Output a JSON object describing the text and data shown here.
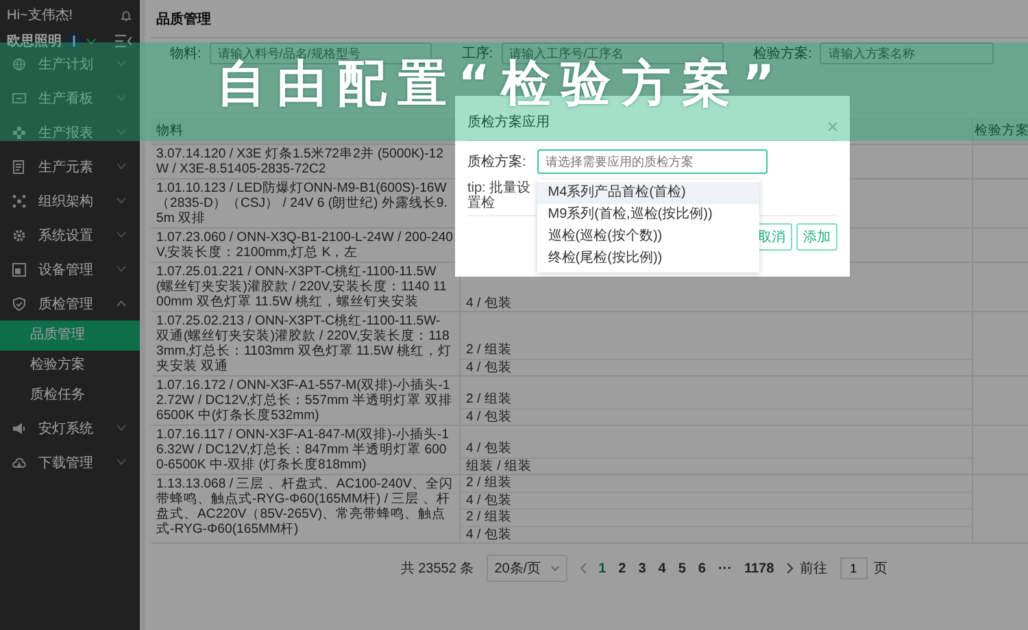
{
  "sidebar": {
    "greeting": "Hi~支伟杰!",
    "company": "欧思照明",
    "items": [
      {
        "label": "生产计划",
        "expanded": false
      },
      {
        "label": "生产看板",
        "expanded": false
      },
      {
        "label": "生产报表",
        "expanded": false
      },
      {
        "label": "生产元素",
        "expanded": false
      },
      {
        "label": "组织架构",
        "expanded": false
      },
      {
        "label": "系统设置",
        "expanded": false
      },
      {
        "label": "设备管理",
        "expanded": false
      },
      {
        "label": "质检管理",
        "expanded": true,
        "children": [
          {
            "label": "品质管理",
            "selected": true
          },
          {
            "label": "检验方案",
            "selected": false
          },
          {
            "label": "质检任务",
            "selected": false
          }
        ]
      },
      {
        "label": "安灯系统",
        "expanded": false
      },
      {
        "label": "下载管理",
        "expanded": false
      }
    ]
  },
  "page_title": "品质管理",
  "filters": [
    {
      "label": "物料:",
      "placeholder": "请输入料号/品名/规格型号"
    },
    {
      "label": "工序:",
      "placeholder": "请输入工序号/工序名"
    },
    {
      "label": "检验方案:",
      "placeholder": "请输入方案名称"
    }
  ],
  "table": {
    "columns": {
      "material": "物料",
      "scheme": "检验方案"
    },
    "rows": [
      {
        "material": "3.07.14.120 / X3E 灯条1.5米72串2并 (5000K)-12W / X3E-8.51405-2835-72C2"
      },
      {
        "material": "1.01.10.123 / LED防爆灯ONN-M9-B1(600S)-16W（2835-D）（CSJ） / 24V 6 (朗世纪) 外露线长9.5m 双排"
      },
      {
        "material": "1.07.23.060 / ONN-X3Q-B1-2100-L-24W / 200-240V,安装长度：2100mm,灯总 K，左"
      },
      {
        "material": "1.07.25.01.221 / ONN-X3PT-C桃红-1100-11.5W(螺丝钉夹安装)灌胶款 / 220V,安装长度：1140 1100mm 双色灯罩 11.5W 桃红，螺丝钉夹安装",
        "processes": [
          "4 / 包装"
        ]
      },
      {
        "material": "1.07.25.02.213 / ONN-X3PT-C桃红-1100-11.5W-双通(螺丝钉夹安装)灌胶款 / 220V,安装长度：1183mm,灯总长：1103mm 双色灯罩 11.5W 桃红，灯夹安装 双通",
        "processes": [
          "2 / 组装",
          "4 / 包装"
        ]
      },
      {
        "material": "1.07.16.172 / ONN-X3F-A1-557-M(双排)-小插头-12.72W / DC12V,灯总长：557mm 半透明灯罩 双排6500K 中(灯条长度532mm)",
        "processes": [
          "2 / 组装",
          "4 / 包装"
        ]
      },
      {
        "material": "1.07.16.117 / ONN-X3F-A1-847-M(双排)-小插头-16.32W / DC12V,灯总长：847mm 半透明灯罩 6000-6500K 中-双排 (灯条长度818mm)",
        "processes": [
          "4 / 包装",
          "组装 / 组装"
        ]
      },
      {
        "material": "1.13.13.068 / 三层 、杆盘式、AC100-240V、全闪带蜂鸣、触点式-RYG-Φ60(165MM杆) / 三层 、杆盘式、AC220V（85V-265V)、常亮带蜂鸣、触点式-RYG-Φ60(165MM杆)",
        "processes": [
          "2 / 组装",
          "4 / 包装",
          "2 / 组装",
          "4 / 包装"
        ]
      }
    ]
  },
  "pagination": {
    "total": "共 23552 条",
    "page_size": "20条/页",
    "pages": [
      {
        "label": "1",
        "selected": true
      },
      {
        "label": "2",
        "selected": false
      },
      {
        "label": "3",
        "selected": false
      },
      {
        "label": "4",
        "selected": false
      },
      {
        "label": "5",
        "selected": false
      },
      {
        "label": "6",
        "selected": false
      },
      {
        "label": "···",
        "selected": false
      },
      {
        "label": "1178",
        "selected": false
      }
    ],
    "jump_label": "前往",
    "jump_value": "1",
    "jump_suffix": "页"
  },
  "dialog": {
    "title": "质检方案应用",
    "field_label": "质检方案:",
    "placeholder": "请选择需要应用的质检方案",
    "tip": "tip: 批量设置检",
    "buttons": [
      "取消",
      "添加"
    ],
    "options": [
      {
        "label": "M4系列产品首检(首检)",
        "selected": true
      },
      {
        "label": "M9系列(首检,巡检(按比例))",
        "selected": false
      },
      {
        "label": "巡检(巡检(按个数))",
        "selected": false
      },
      {
        "label": "终检(尾检(按比例))",
        "selected": false
      }
    ]
  },
  "banner": {
    "text": "自由配置“检验方案”"
  }
}
